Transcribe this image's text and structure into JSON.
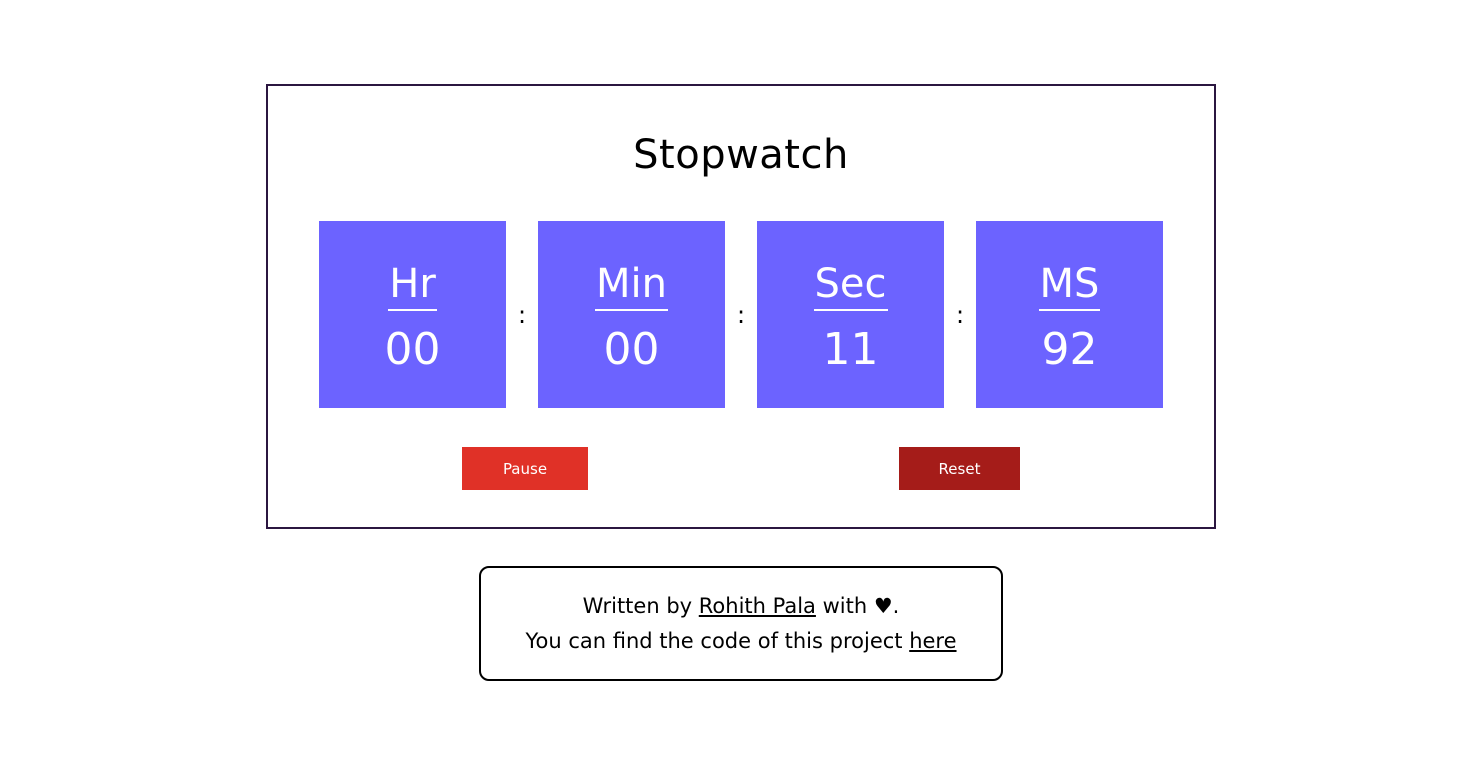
{
  "stopwatch": {
    "title": "Stopwatch",
    "units": [
      {
        "label": "Hr",
        "value": "00"
      },
      {
        "label": "Min",
        "value": "00"
      },
      {
        "label": "Sec",
        "value": "11"
      },
      {
        "label": "MS",
        "value": "92"
      }
    ],
    "separator": ":",
    "pause_label": "Pause",
    "reset_label": "Reset"
  },
  "credit": {
    "line1_prefix": "Written by ",
    "author_link": "Rohith Pala",
    "line1_suffix": " with ♥.",
    "line2_prefix": "You can find the code of this project ",
    "code_link": "here"
  },
  "colors": {
    "unit_bg": "#6c63ff",
    "pause_bg": "#e03127",
    "reset_bg": "#a51c19",
    "border": "#2b1640"
  }
}
